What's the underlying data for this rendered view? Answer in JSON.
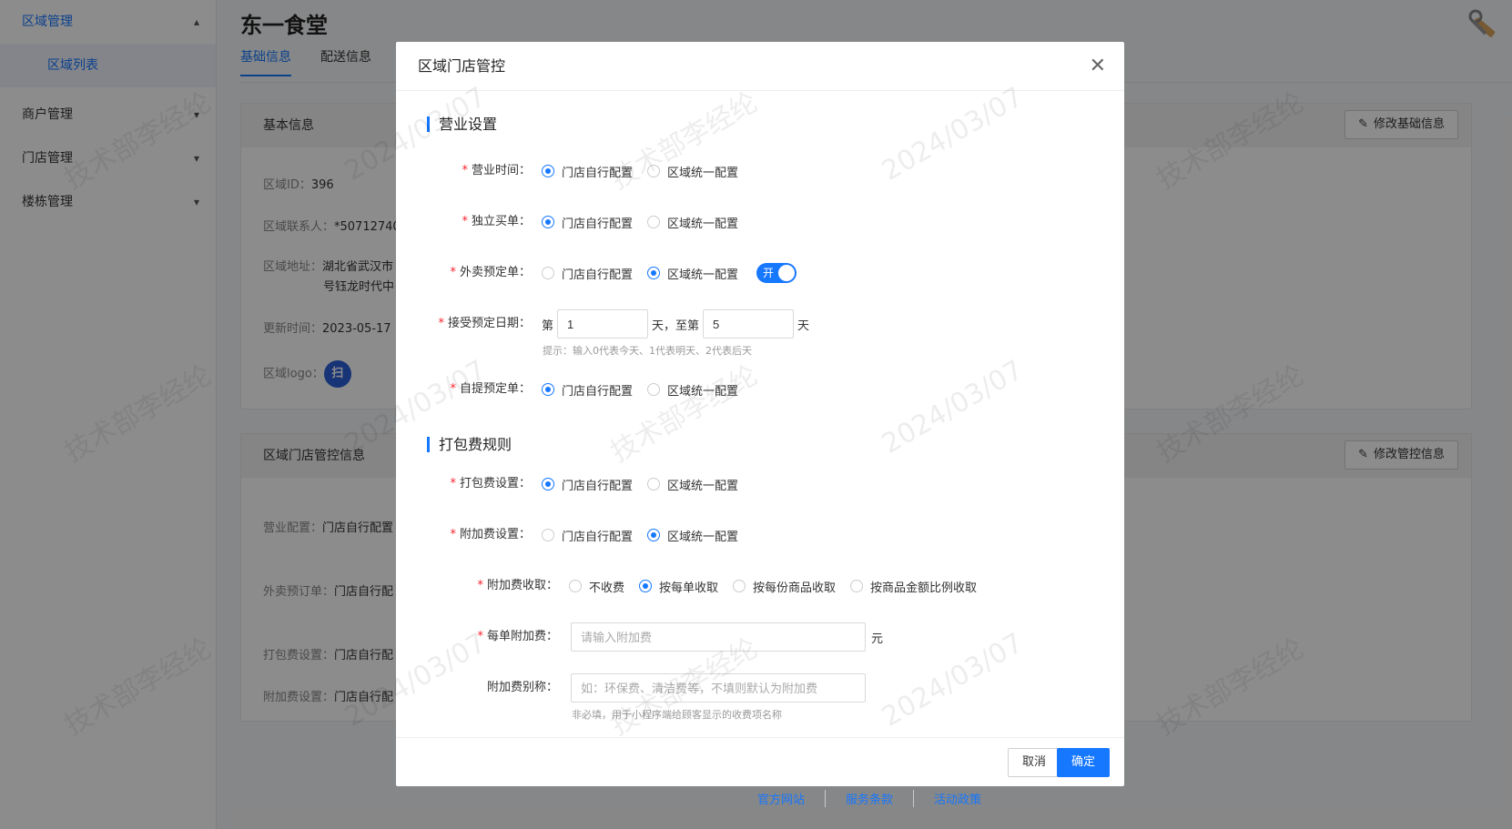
{
  "sidebar": {
    "groups": [
      {
        "label": "区域管理",
        "chevron": "▴"
      },
      {
        "label": "商户管理",
        "chevron": "▾"
      },
      {
        "label": "门店管理",
        "chevron": "▾"
      },
      {
        "label": "楼栋管理",
        "chevron": "▾"
      }
    ],
    "active_item": "区域列表"
  },
  "page": {
    "title": "东一食堂",
    "tabs": [
      "基础信息",
      "配送信息"
    ]
  },
  "basic_card": {
    "title": "基本信息",
    "edit_button": "修改基础信息",
    "rows": [
      {
        "key": "区域ID：",
        "value": "396"
      },
      {
        "key": "区域联系人：",
        "value": "*50712740"
      },
      {
        "key": "区域地址：",
        "value": "湖北省武汉市"
      },
      {
        "key": "",
        "value": "号钰龙时代中"
      },
      {
        "key": "更新时间：",
        "value": "2023-05-17"
      },
      {
        "key": "区域logo：",
        "value": ""
      }
    ],
    "logo_glyph": "扫"
  },
  "control_card": {
    "title": "区域门店管控信息",
    "edit_button": "修改管控信息",
    "rows": [
      {
        "key": "营业配置：",
        "value": "门店自行配置"
      },
      {
        "key": "外卖预订单：",
        "value": "门店自行配"
      },
      {
        "key": "打包费设置：",
        "value": "门店自行配"
      },
      {
        "key": "附加费设置：",
        "value": "门店自行配"
      }
    ]
  },
  "footer": {
    "links": [
      "官方网站",
      "服务条款",
      "活动政策"
    ]
  },
  "watermark": {
    "text1": "技术部李经纶",
    "text2": "2024/03/07"
  },
  "modal": {
    "title": "区域门店管控",
    "section1": "营业设置",
    "section2": "打包费规则",
    "opt_store": "门店自行配置",
    "opt_region": "区域统一配置",
    "business_hours": {
      "label": "营业时间：",
      "selected": "门店自行配置"
    },
    "independent_order": {
      "label": "独立买单：",
      "selected": "门店自行配置"
    },
    "delivery_preorder": {
      "label": "外卖预定单：",
      "selected": "区域统一配置",
      "switch_text": "开"
    },
    "preorder_date": {
      "label": "接受预定日期：",
      "prefix": "第",
      "from": "1",
      "mid": "天，至第",
      "to": "5",
      "suffix": "天",
      "hint": "提示：输入0代表今天、1代表明天、2代表后天"
    },
    "pickup_preorder": {
      "label": "自提预定单：",
      "selected": "门店自行配置"
    },
    "packing_fee": {
      "label": "打包费设置：",
      "selected": "门店自行配置"
    },
    "surcharge": {
      "label": "附加费设置：",
      "selected": "区域统一配置"
    },
    "surcharge_mode": {
      "label": "附加费收取：",
      "options": [
        "不收费",
        "按每单收取",
        "按每份商品收取",
        "按商品金额比例收取"
      ],
      "selected": "按每单收取"
    },
    "per_order_fee": {
      "label": "每单附加费：",
      "placeholder": "请输入附加费",
      "unit": "元"
    },
    "fee_alias": {
      "label": "附加费别称：",
      "placeholder": "如：环保费、清洁费等，不填则默认为附加费",
      "hint": "非必填，用于小程序端给顾客显示的收费项名称"
    },
    "cancel_label": "取消",
    "ok_label": "确定"
  }
}
